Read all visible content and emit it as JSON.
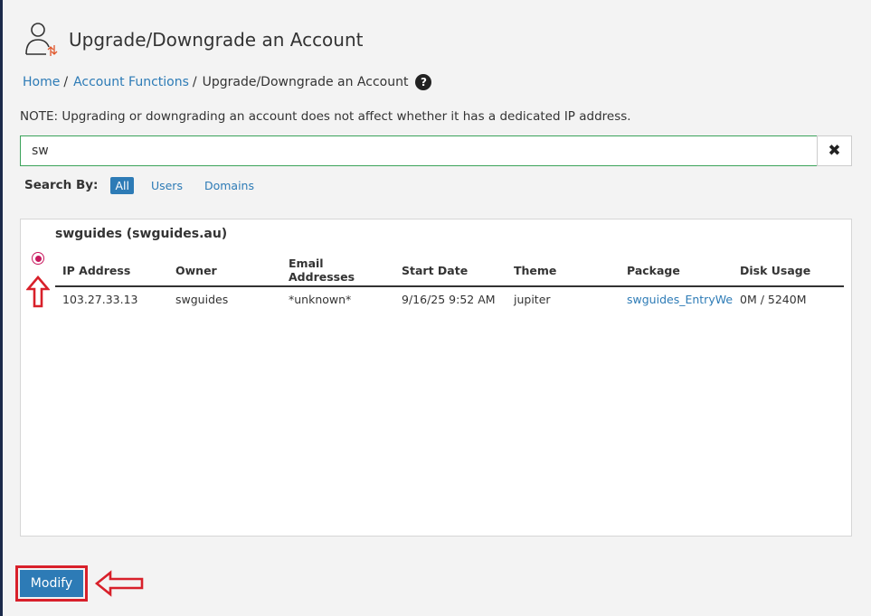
{
  "header": {
    "title": "Upgrade/Downgrade an Account",
    "icon": "user-swap-icon"
  },
  "breadcrumb": {
    "items": [
      {
        "label": "Home"
      },
      {
        "label": "Account Functions"
      },
      {
        "label": "Upgrade/Downgrade an Account"
      }
    ],
    "separator": "/",
    "help_glyph": "?"
  },
  "note": "NOTE: Upgrading or downgrading an account does not affect whether it has a dedicated IP address.",
  "search": {
    "value": "sw",
    "clear_glyph": "✖"
  },
  "search_by": {
    "label": "Search By:",
    "options": [
      {
        "label": "All",
        "active": true
      },
      {
        "label": "Users",
        "active": false
      },
      {
        "label": "Domains",
        "active": false
      }
    ]
  },
  "account": {
    "title": "swguides (swguides.au)",
    "columns": [
      "IP Address",
      "Owner",
      "Email Addresses",
      "Start Date",
      "Theme",
      "Package",
      "Disk Usage"
    ],
    "row": {
      "ip": "103.27.33.13",
      "owner": "swguides",
      "email": "*unknown*",
      "start_date": "9/16/25 9:52 AM",
      "theme": "jupiter",
      "package": "swguides_EntryWeb...",
      "disk_usage": "0M / 5240M"
    }
  },
  "actions": {
    "modify_label": "Modify"
  },
  "colors": {
    "accent": "#2d7bb6",
    "radio": "#c8185e",
    "annotation": "#d8202a",
    "search_border": "#3ba35a"
  }
}
